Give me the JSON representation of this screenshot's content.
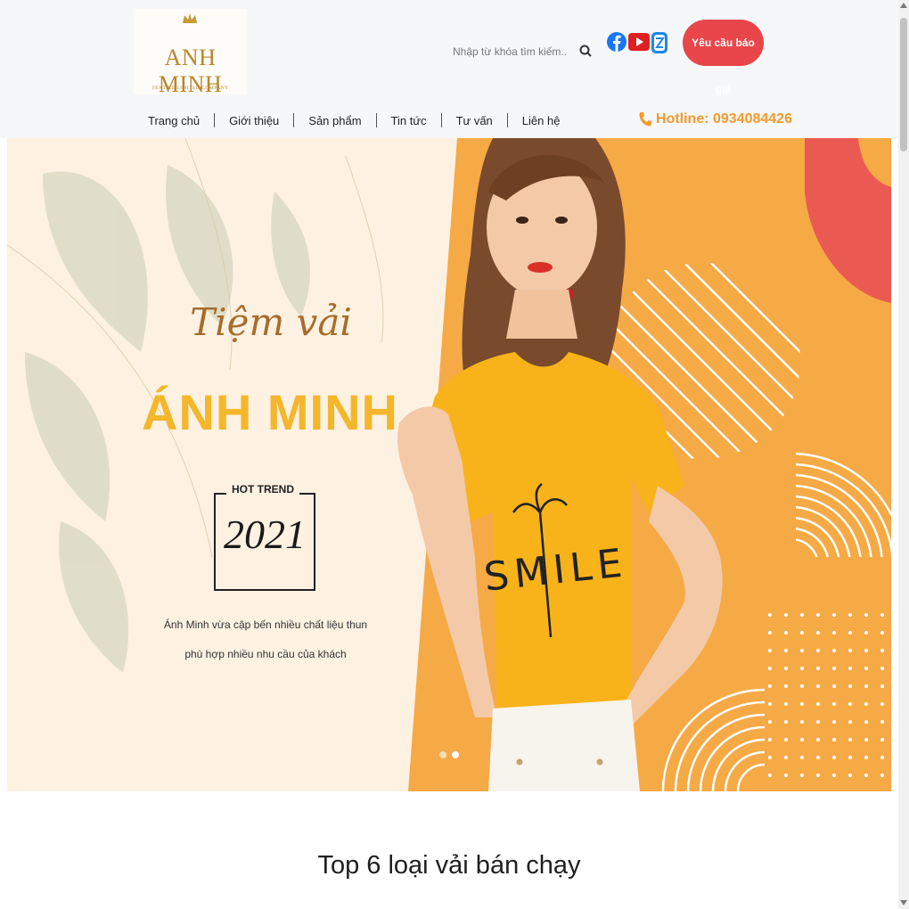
{
  "header": {
    "logo": {
      "name": "ANH MINH",
      "subtitle": "TEXTILE LIMITED COMPANY"
    },
    "search": {
      "placeholder": "Nhập từ khóa tìm kiếm..."
    },
    "social": [
      "facebook-icon",
      "youtube-icon",
      "zalo-icon"
    ],
    "quote_button": "Yêu cầu báo giá",
    "nav": [
      "Trang chủ",
      "Giới thiệu",
      "Sản phẩm",
      "Tin tức",
      "Tư vấn",
      "Liên hệ"
    ],
    "hotline": "Hotline: 0934084426"
  },
  "banner": {
    "script_title": "Tiệm vải",
    "brand": "ÁNH MINH",
    "trend_label": "HOT TREND",
    "trend_year": "2021",
    "desc_line1": "Ánh Minh vừa cập bến nhiều chất liệu thun",
    "desc_line2": "phù hợp nhiều nhu cầu của khách",
    "shirt_text": "SMILE",
    "slides": 2,
    "active_slide": 2
  },
  "section": {
    "title": "Top 6 loại vải bán chạy"
  },
  "colors": {
    "accent": "#e8464a",
    "orange": "#f39a2b",
    "gold": "#f4b62a",
    "brown": "#a66d2a"
  }
}
